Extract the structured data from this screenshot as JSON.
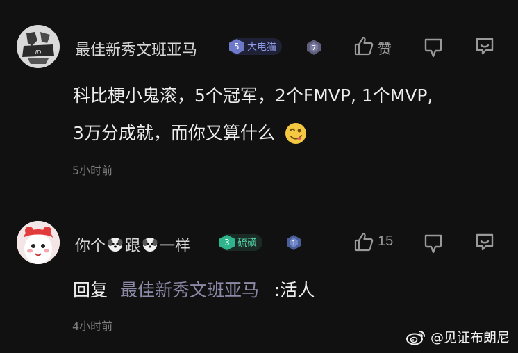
{
  "comments": [
    {
      "username": "最佳新秀文班亚马",
      "badge": {
        "level": "5",
        "label": "大电猫",
        "color": "#6f79c9"
      },
      "rank_badge": "7",
      "like_label": "赞",
      "body_lines": [
        "科比梗小鬼滚，5个冠军，2个FMVP, 1个MVP,",
        "3万分成就，而你又算什么"
      ],
      "emoji": "smiling-tongue-emoji",
      "time": "5小时前"
    },
    {
      "username_parts": [
        "你个",
        "跟",
        "一样"
      ],
      "badge": {
        "level": "3",
        "label": "硫磺",
        "color": "#2fb58e"
      },
      "rank_badge": "1",
      "like_count": "15",
      "reply_prefix": "回复",
      "reply_target": "最佳新秀文班亚马",
      "reply_text": ":活人",
      "time": "4小时前"
    }
  ],
  "watermark": {
    "text": "@见证布朗尼",
    "icon": "weibo-logo"
  },
  "colors": {
    "background": "#111111",
    "text_primary": "#ededed",
    "text_secondary": "#7e7e7e",
    "reply_link": "#8d8aa8",
    "icon_gray": "#9a9a9a"
  }
}
